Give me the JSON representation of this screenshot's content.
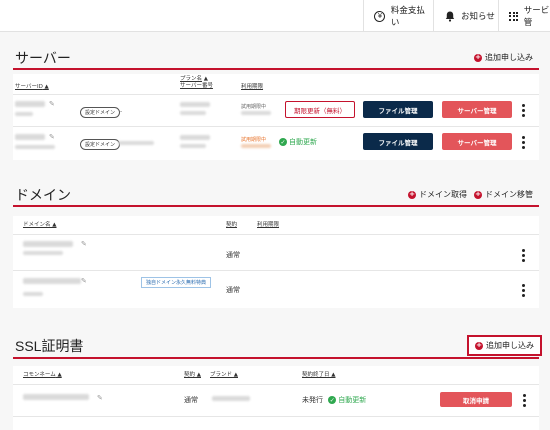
{
  "topbar": {
    "payment_label": "料金支払い",
    "notice_label": "お知らせ",
    "services_label": "サービス管"
  },
  "server": {
    "title": "サーバー",
    "add_label": "追加申し込み",
    "headers": {
      "server_id": "サーバーID",
      "plan_name": "プラン名",
      "server_number": "サーバー番号",
      "period": "利用期限"
    },
    "rows": [
      {
        "domain_pill": "設定ドメイン",
        "domain_value": "-",
        "period_label": "試用期限中",
        "renew_button": "期限更新（無料）",
        "file_button": "ファイル管理",
        "server_button": "サーバー管理"
      },
      {
        "domain_pill": "設定ドメイン",
        "period_label": "試用期限中",
        "auto_renew": "自動更新",
        "file_button": "ファイル管理",
        "server_button": "サーバー管理"
      }
    ]
  },
  "domain": {
    "title": "ドメイン",
    "acquire_label": "ドメイン取得",
    "transfer_label": "ドメイン移管",
    "headers": {
      "domain_name": "ドメイン名",
      "contract": "契約",
      "period": "利用期限"
    },
    "rows": [
      {
        "contract": "通常"
      },
      {
        "tag": "独自ドメイン永久無料特典",
        "contract": "通常"
      }
    ]
  },
  "ssl": {
    "title": "SSL証明書",
    "add_label": "追加申し込み",
    "headers": {
      "common_name": "コモンネーム",
      "contract": "契約",
      "brand": "ブランド",
      "end_date": "契約終了日"
    },
    "rows": [
      {
        "contract": "通常",
        "status": "未発行",
        "auto_renew": "自動更新",
        "cancel_button": "取消申請"
      }
    ]
  },
  "colors": {
    "accent_red": "#c4122d",
    "navy": "#0b2a4a",
    "button_red": "#e3555a",
    "green": "#2fa84f"
  }
}
